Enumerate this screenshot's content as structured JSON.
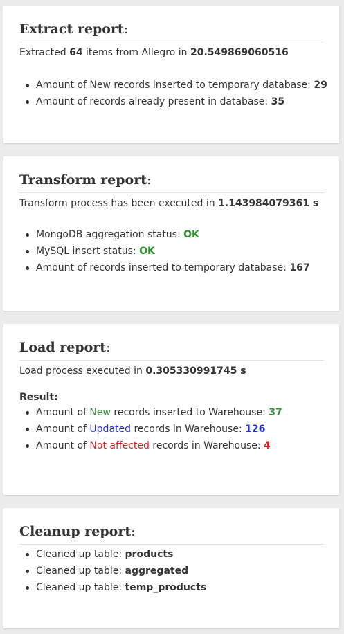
{
  "extract": {
    "title": "Extract report",
    "colon": ":",
    "summary_prefix": "Extracted",
    "items_count": "64",
    "summary_middle": "items from Allegro in",
    "duration": "20.549869060516",
    "rows": [
      {
        "label": "Amount of New records inserted to temporary database:",
        "value": "29"
      },
      {
        "label": "Amount of records already present in database:",
        "value": "35"
      }
    ]
  },
  "transform": {
    "title": "Transform report",
    "colon": ":",
    "summary_prefix": "Transform process has been executed in",
    "duration": "1.143984079361 s",
    "rows": [
      {
        "label": "MongoDB aggregation status:",
        "value": "OK"
      },
      {
        "label": "MySQL insert status:",
        "value": "OK"
      },
      {
        "label": "Amount of records inserted to temporary database:",
        "value": "167"
      }
    ]
  },
  "load": {
    "title": "Load report",
    "colon": ":",
    "summary_prefix": "Load process executed in",
    "duration": "0.305330991745 s",
    "result_label": "Result:",
    "rows": [
      {
        "prefix": "Amount of",
        "keyword": "New",
        "suffix": "records inserted to Warehouse:",
        "value": "37",
        "color": "#2f8f2f"
      },
      {
        "prefix": "Amount of",
        "keyword": "Updated",
        "suffix": "records in Warehouse:",
        "value": "126",
        "color": "#1f2fd0"
      },
      {
        "prefix": "Amount of",
        "keyword": "Not affected",
        "suffix": "records in Warehouse:",
        "value": "4",
        "color": "#e02020"
      }
    ]
  },
  "cleanup": {
    "title": "Cleanup report",
    "colon": ":",
    "rows": [
      {
        "label": "Cleaned up table:",
        "value": "products"
      },
      {
        "label": "Cleaned up table:",
        "value": "aggregated"
      },
      {
        "label": "Cleaned up table:",
        "value": "temp_products"
      }
    ]
  }
}
